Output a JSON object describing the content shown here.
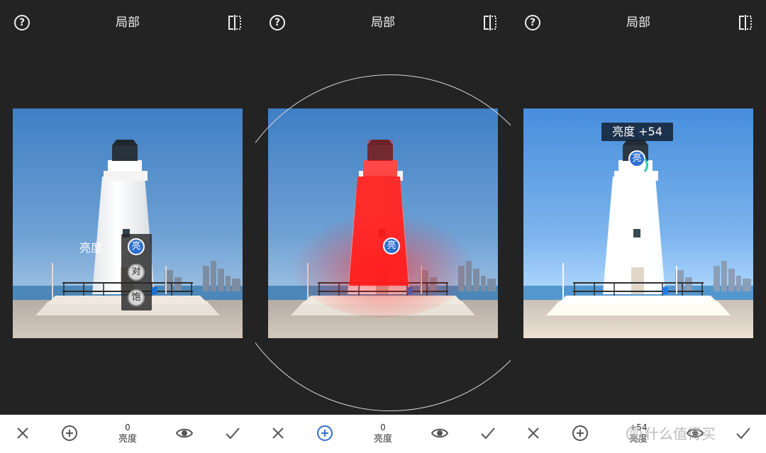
{
  "panels": [
    {
      "title": "局部",
      "hover_label": "亮度",
      "tool_menu": [
        "亮",
        "对",
        "饱"
      ],
      "control_pin": "",
      "value_tip": "",
      "bottom": {
        "value": "0",
        "label": "亮度",
        "add_active": false
      }
    },
    {
      "title": "局部",
      "hover_label": "",
      "tool_menu": [],
      "control_pin": "亮",
      "value_tip": "",
      "bottom": {
        "value": "0",
        "label": "亮度",
        "add_active": true
      }
    },
    {
      "title": "局部",
      "hover_label": "",
      "tool_menu": [],
      "control_pin": "亮",
      "value_tip": "亮度 +54",
      "bottom": {
        "value": "+54",
        "label": "亮度",
        "add_active": false
      }
    }
  ],
  "icons": {
    "help": "help-circle-icon",
    "compare": "compare-icon",
    "close": "close-icon",
    "add": "add-circle-icon",
    "eye": "eye-icon",
    "check": "check-icon"
  },
  "colors": {
    "accent": "#2f6fd1",
    "mask": "#ff1a1a",
    "toolbar_bg": "#232323"
  },
  "watermark": {
    "logo": "值",
    "text": "什么值得买"
  }
}
